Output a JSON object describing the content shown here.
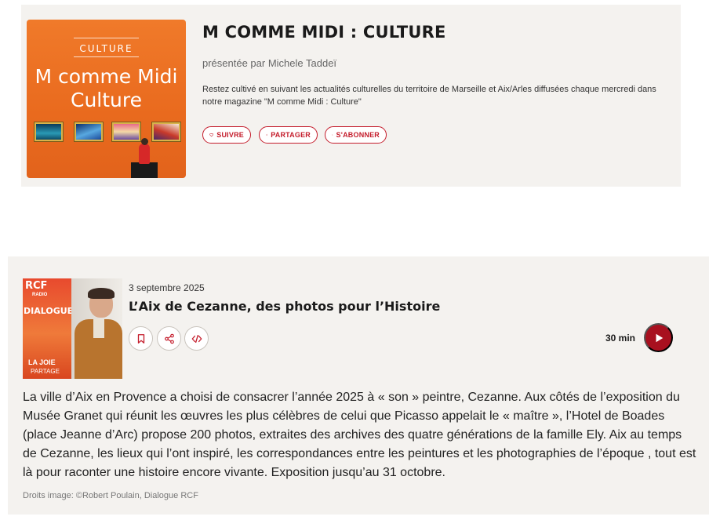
{
  "show": {
    "cover": {
      "kicker": "CULTURE",
      "title_line1": "M comme Midi",
      "title_line2": "Culture"
    },
    "title": "M COMME MIDI : CULTURE",
    "presenter": "présentée par Michele Taddeï",
    "description": "Restez cultivé en suivant les actualités culturelles du territoire de Marseille et Aix/Arles diffusées chaque mercredi dans notre magazine \"M comme Midi : Culture\"",
    "buttons": {
      "follow": "SUIVRE",
      "share": "PARTAGER",
      "subscribe": "S'ABONNER"
    }
  },
  "episode": {
    "thumbnail": {
      "logo": "RCF",
      "logo_sub": "RADIO",
      "banner": "DIALOGUE",
      "slogan_1": "LA JOIE",
      "slogan_2": "PARTAGE"
    },
    "date": "3 septembre 2025",
    "title": "L’Aix de Cezanne, des photos pour l’Histoire",
    "duration": "30 min",
    "description": "La ville d’Aix en Provence a choisi de consacrer l’année 2025 à « son » peintre, Cezanne. Aux côtés de l’exposition du Musée Granet qui réunit les œuvres les plus célèbres de celui que Picasso appelait le « maître », l’Hotel de Boades (place Jeanne d’Arc) propose 200 photos, extraites des archives des quatre générations de la famille Ely. Aix au temps de Cezanne, les lieux qui l’ont inspiré, les correspondances entre les peintures et les photographies de l’époque , tout est là pour raconter une histoire encore vivante. Exposition jusqu’au 31 octobre.",
    "credit": "Droits image: ©Robert Poulain, Dialogue RCF",
    "icons": {
      "bookmark": "bookmark-icon",
      "share": "share-icon",
      "embed": "code-icon",
      "play": "play-icon"
    }
  },
  "colors": {
    "accent": "#c41c2b",
    "play": "#a8101f",
    "card_bg": "#f4f2ef",
    "cover_orange": "#ec6f22"
  }
}
